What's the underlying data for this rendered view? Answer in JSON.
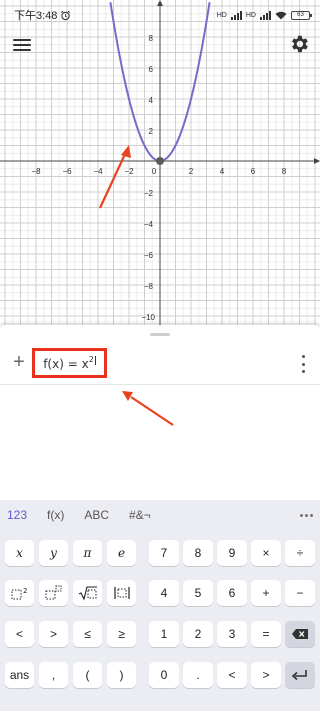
{
  "status_bar": {
    "time": "下午3:48",
    "network_label_1": "HD",
    "network_label_2": "HD",
    "battery": "63"
  },
  "graph": {
    "x_ticks": [
      "−8",
      "−6",
      "−4",
      "−2",
      "0",
      "2",
      "4",
      "6",
      "8"
    ],
    "y_ticks": [
      "8",
      "6",
      "4",
      "2",
      "−2",
      "−4",
      "−6",
      "−8",
      "−10"
    ],
    "curve_color": "#7b68c8",
    "origin_point_color": "#5a5a5a"
  },
  "algebra": {
    "expression": {
      "base": "f(x) = x",
      "exponent": "2"
    },
    "highlight_color": "#e8321e",
    "annotation_color": "#e8431f"
  },
  "keyboard": {
    "tabs": [
      "123",
      "f(x)",
      "ABC",
      "#&¬"
    ],
    "active_tab": "123",
    "rows": [
      [
        "x",
        "y",
        "π",
        "e"
      ],
      [
        "x²",
        "□□",
        "√□",
        "|□|"
      ],
      [
        "<",
        ">",
        "≤",
        "≥"
      ],
      [
        "ans",
        ",",
        "(",
        ")"
      ]
    ],
    "numpad": [
      [
        "7",
        "8",
        "9",
        "×",
        "÷"
      ],
      [
        "4",
        "5",
        "6",
        "+",
        "−"
      ],
      [
        "1",
        "2",
        "3",
        "=",
        "⌫"
      ],
      [
        "0",
        ".",
        "<",
        ">",
        "↵"
      ]
    ],
    "accent_color": "#6557d2"
  }
}
